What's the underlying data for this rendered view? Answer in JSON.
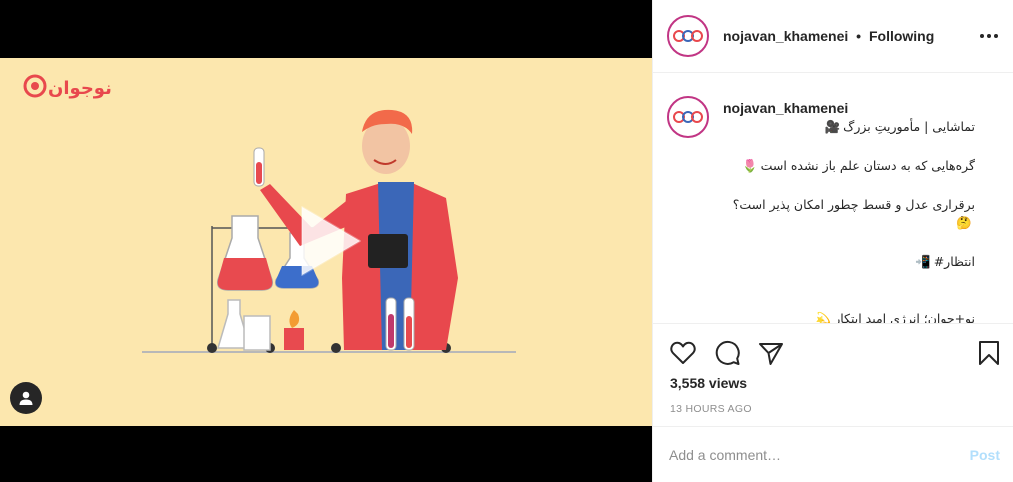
{
  "colors": {
    "video_bg": "#fce7ae",
    "brand_red": "#e8484d",
    "text_primary": "#262626",
    "text_secondary": "#8e8e8e",
    "post_disabled": "#b2dffc",
    "story_ring": "#c13584"
  },
  "video": {
    "watermark_text": "نوجوان",
    "play_icon": "play-icon",
    "user_tag_icon": "person-icon"
  },
  "header": {
    "username": "nojavan_khamenei",
    "separator": "•",
    "follow_status": "Following",
    "more_icon": "more-options-icon"
  },
  "caption": {
    "username": "nojavan_khamenei",
    "lines": [
      {
        "text": "تماشایی | مأموریتِ بزرگ",
        "emoji": "🎥"
      },
      {
        "text": "گره‌هایی که به دستان علم باز نشده است",
        "emoji": "🌷"
      },
      {
        "text": "برقراری عدل و قسط چطور امکان پذیر است؟",
        "emoji": "🤔"
      },
      {
        "text": "انتظار#",
        "emoji": "📲"
      },
      {
        "text": "نو+جوان؛ انرژی امید ابتکار",
        "emoji": "💫"
      }
    ]
  },
  "actions": {
    "like_icon": "heart-icon",
    "comment_icon": "comment-icon",
    "share_icon": "share-icon",
    "save_icon": "bookmark-icon",
    "views": "3,558 views",
    "timestamp": "13 HOURS AGO"
  },
  "comment": {
    "placeholder": "Add a comment…",
    "post_label": "Post"
  }
}
